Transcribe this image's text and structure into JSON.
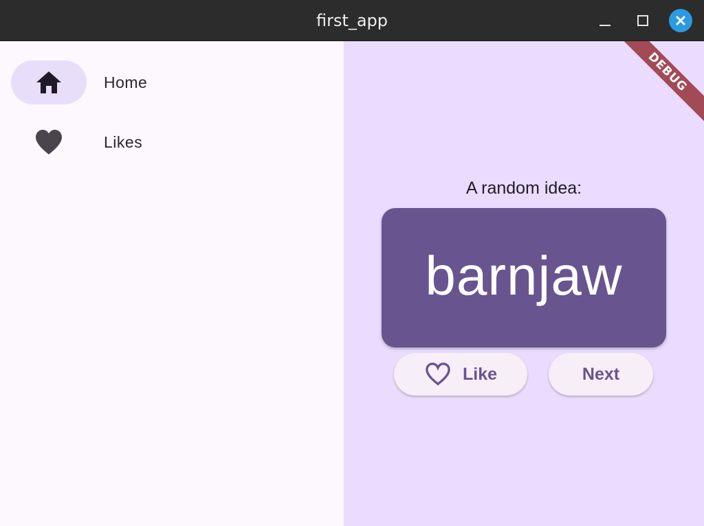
{
  "window": {
    "title": "first_app",
    "controls": [
      "minimize-icon",
      "maximize-icon",
      "close-icon"
    ]
  },
  "sidebar": {
    "items": [
      {
        "label": "Home",
        "icon": "home-icon",
        "selected": true
      },
      {
        "label": "Likes",
        "icon": "heart-icon",
        "selected": false
      }
    ]
  },
  "main": {
    "debug_banner": "DEBUG",
    "idea_label": "A random idea:",
    "word": "barnjaw",
    "like_button": {
      "label": "Like",
      "icon": "heart-outline-icon"
    },
    "next_button": {
      "label": "Next"
    }
  },
  "colors": {
    "card": "#68548f",
    "main_background": "#e9dcfe",
    "rail_background": "#fdf7fe",
    "indicator": "#e9defa",
    "close_button": "#2b9be0",
    "debug_banner": "#a34a57"
  }
}
